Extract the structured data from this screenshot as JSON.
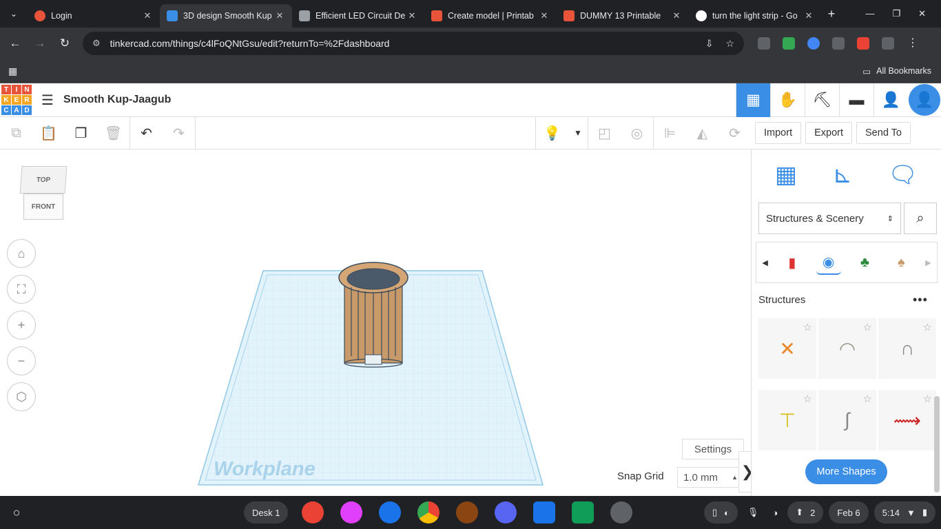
{
  "browser": {
    "tabs": [
      {
        "title": "Login",
        "color": "#e8543a"
      },
      {
        "title": "3D design Smooth Kup",
        "color": "#3a8ee6"
      },
      {
        "title": "Efficient LED Circuit De",
        "color": "#9aa0a6"
      },
      {
        "title": "Create model | Printab",
        "color": "#e8543a"
      },
      {
        "title": "DUMMY 13 Printable",
        "color": "#e8543a"
      },
      {
        "title": "turn the light strip - Go",
        "color": "#ffffff"
      }
    ],
    "url": "tinkercad.com/things/c4lFoQNtGsu/edit?returnTo=%2Fdashboard",
    "all_bookmarks": "All Bookmarks"
  },
  "app": {
    "logo": [
      "T",
      "I",
      "N",
      "K",
      "E",
      "R",
      "C",
      "A",
      "D"
    ],
    "logo_colors": [
      "#e8543a",
      "#e8543a",
      "#e8543a",
      "#f5a623",
      "#f5a623",
      "#f5a623",
      "#3a8ee6",
      "#3a8ee6",
      "#3a8ee6"
    ],
    "design_title": "Smooth Kup-Jaagub"
  },
  "right_actions": {
    "import": "Import",
    "export": "Export",
    "send_to": "Send To"
  },
  "viewcube": {
    "top": "TOP",
    "front": "FRONT"
  },
  "workplane": {
    "label": "Workplane",
    "settings": "Settings",
    "snap_label": "Snap Grid",
    "snap_value": "1.0 mm"
  },
  "panel": {
    "category": "Structures & Scenery",
    "section": "Structures",
    "more_shapes": "More Shapes"
  },
  "shelf": {
    "desk": "Desk 1",
    "notifications": "2",
    "date": "Feb 6",
    "time": "5:14"
  },
  "colors": {
    "accent": "#3a8ee6",
    "chrome_dark": "#202124",
    "chrome_mid": "#35363a"
  }
}
